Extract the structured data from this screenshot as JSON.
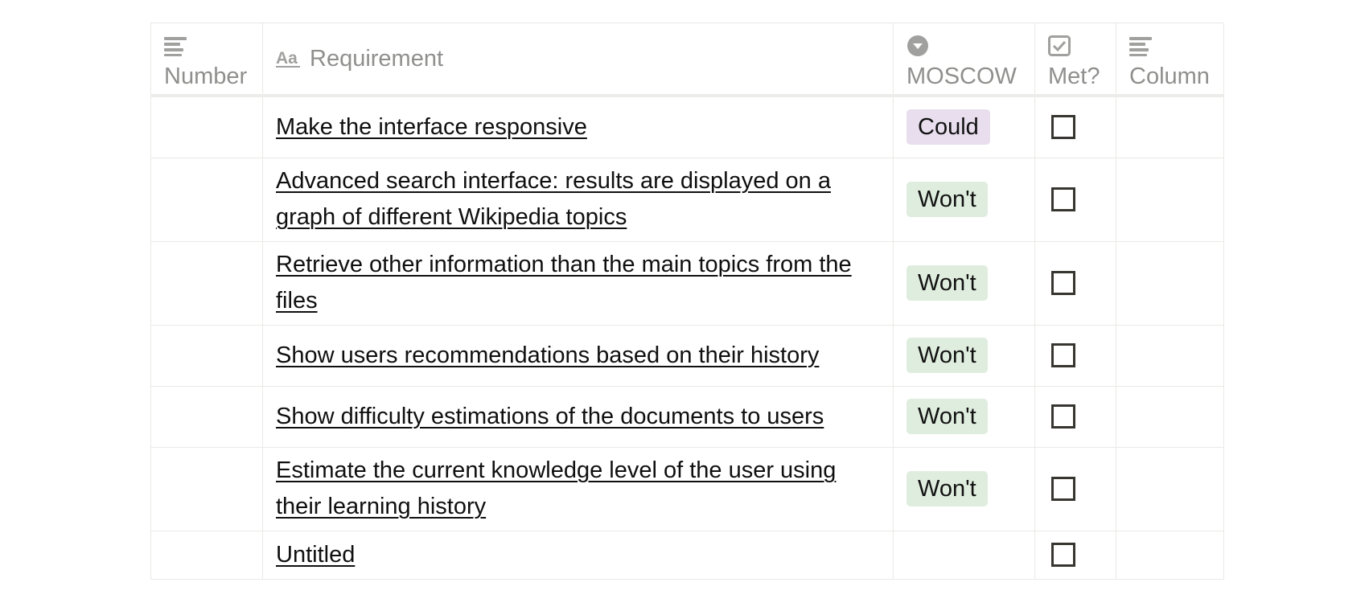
{
  "table": {
    "columns": [
      {
        "label": "Number",
        "icon": "text-lines-icon"
      },
      {
        "label": "Requirement",
        "icon": "title-aa-icon"
      },
      {
        "label": "MOSCOW",
        "icon": "select-dropdown-icon"
      },
      {
        "label": "Met?",
        "icon": "checkbox-icon"
      },
      {
        "label": "Column",
        "icon": "text-lines-icon"
      }
    ],
    "rows": [
      {
        "number": "",
        "requirement": "Make the interface responsive",
        "moscow": "Could",
        "met": false,
        "column": ""
      },
      {
        "number": "",
        "requirement": "Advanced search interface: results are displayed on a graph of different Wikipedia topics",
        "moscow": "Won't",
        "met": false,
        "column": ""
      },
      {
        "number": "",
        "requirement": "Retrieve other information than the main topics from the files",
        "moscow": "Won't",
        "met": false,
        "column": ""
      },
      {
        "number": "",
        "requirement": "Show users recommendations based on their history",
        "moscow": "Won't",
        "met": false,
        "column": ""
      },
      {
        "number": "",
        "requirement": "Show difficulty estimations of the documents to users",
        "moscow": "Won't",
        "met": false,
        "column": ""
      },
      {
        "number": "",
        "requirement": "Estimate the current knowledge level of the user using their learning history",
        "moscow": "Won't",
        "met": false,
        "column": ""
      },
      {
        "number": "",
        "requirement": "Untitled",
        "moscow": "",
        "met": false,
        "column": ""
      }
    ]
  },
  "colors": {
    "could_tag_bg": "#e8deee",
    "wont_tag_bg": "#dfedde",
    "header_text": "#8f8f8d",
    "grid_line": "#e9e9e7",
    "icon_gray": "#a0a09e"
  }
}
